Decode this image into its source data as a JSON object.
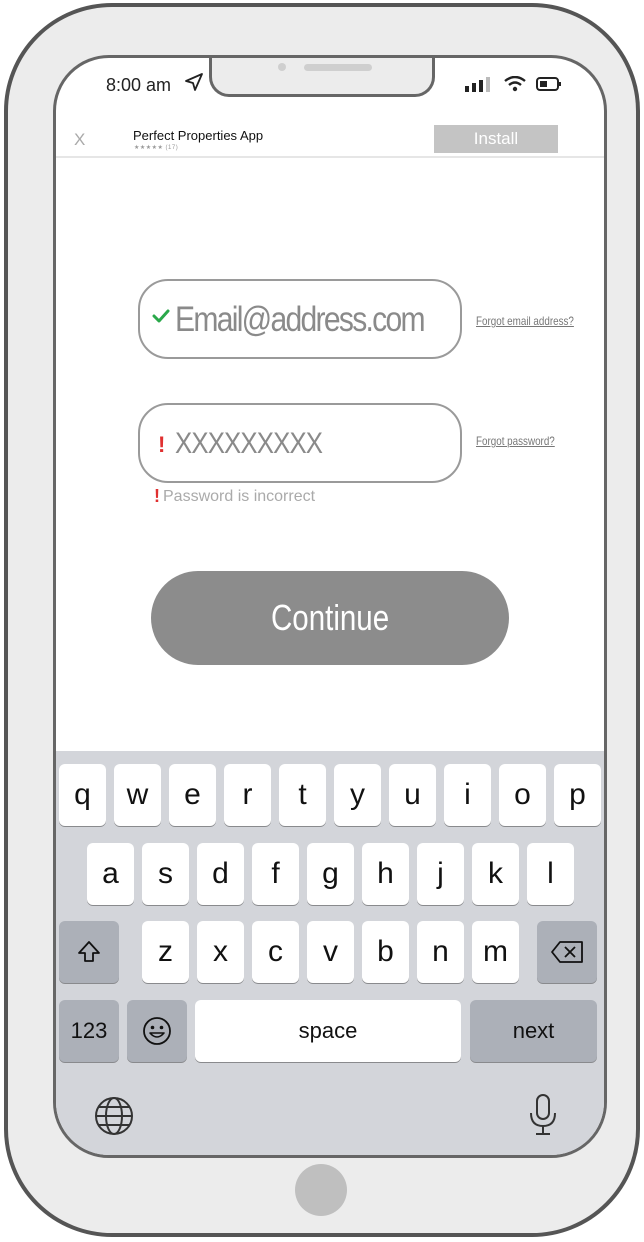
{
  "status_bar": {
    "time": "8:00 am",
    "icons": [
      "location-arrow-icon",
      "signal-icon",
      "wifi-icon",
      "battery-icon"
    ]
  },
  "banner": {
    "close_label": "X",
    "app_name": "Perfect Properties App",
    "rating_text": "★★★★★ (17)",
    "install_label": "Install"
  },
  "form": {
    "email_value": "Email@address.com",
    "email_status_icon": "check-icon",
    "password_value": "XXXXXXXXX",
    "password_status_icon": "!",
    "forgot_email_label": "Forgot email address?",
    "forgot_password_label": "Forgot password?",
    "error_icon": "!",
    "error_message": "Password is incorrect",
    "continue_label": "Continue"
  },
  "keyboard": {
    "row1": [
      "q",
      "w",
      "e",
      "r",
      "t",
      "y",
      "u",
      "i",
      "o",
      "p"
    ],
    "row2": [
      "a",
      "s",
      "d",
      "f",
      "g",
      "h",
      "j",
      "k",
      "l"
    ],
    "row3": [
      "z",
      "x",
      "c",
      "v",
      "b",
      "n",
      "m"
    ],
    "numbers_label": "123",
    "space_label": "space",
    "next_label": "next",
    "icons": [
      "shift-icon",
      "backspace-icon",
      "emoji-icon",
      "globe-icon",
      "microphone-icon"
    ]
  },
  "colors": {
    "check": "#2aa84a",
    "error": "#e03030",
    "button": "#8c8c8c",
    "keyboard_bg": "#d3d5da"
  }
}
